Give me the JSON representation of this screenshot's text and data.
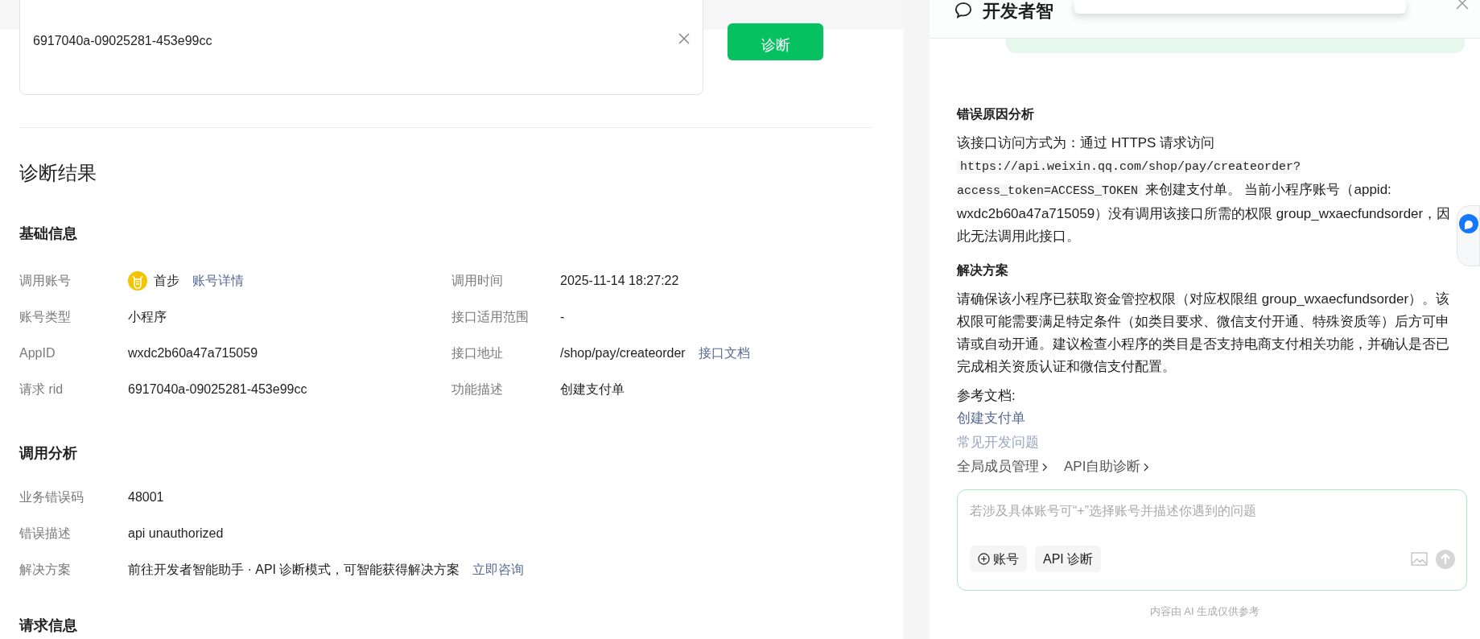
{
  "search": {
    "value": "6917040a-09025281-453e99cc",
    "button": "诊断"
  },
  "result_title": "诊断结果",
  "basic_info": {
    "title": "基础信息",
    "rows": [
      {
        "label": "调用账号",
        "value": "首步",
        "link": "账号详情",
        "avatar": true,
        "label2": "调用时间",
        "value2": "2025-11-14 18:27:22"
      },
      {
        "label": "账号类型",
        "value": "小程序",
        "label2": "接口适用范围",
        "value2": "-"
      },
      {
        "label": "AppID",
        "value": "wxdc2b60a47a715059",
        "label2": "接口地址",
        "value2": "/shop/pay/createorder",
        "link2": "接口文档"
      },
      {
        "label": "请求 rid",
        "value": "6917040a-09025281-453e99cc",
        "label2": "功能描述",
        "value2": "创建支付单"
      }
    ]
  },
  "analysis": {
    "title": "调用分析",
    "rows": [
      {
        "label": "业务错误码",
        "value": "48001"
      },
      {
        "label": "错误描述",
        "value": "api unauthorized"
      },
      {
        "label": "解决方案",
        "value": "前往开发者智能助手 · API 诊断模式，可智能获得解决方案",
        "link": "立即咨询"
      }
    ]
  },
  "request_info_title": "请求信息",
  "assistant": {
    "title": "开发者智",
    "sections": [
      {
        "title": "错误原因分析",
        "parts": [
          {
            "kind": "text",
            "text": "该接口访问方式为：通过 HTTPS 请求访问 "
          },
          {
            "kind": "code",
            "text": "https://api.weixin.qq.com/shop/pay/createorder?access_token=ACCESS_TOKEN"
          },
          {
            "kind": "text",
            "text": " 来创建支付单。 当前小程序账号（appid: wxdc2b60a47a715059）没有调用该接口所需的权限 group_wxaecfundsorder，因此无法调用此接口。"
          }
        ]
      },
      {
        "title": "解决方案",
        "parts": [
          {
            "kind": "text",
            "text": "请确保该小程序已获取资金管控权限（对应权限组 group_wxaecfundsorder）。该权限可能需要满足特定条件（如类目要求、微信支付开通、特殊资质等）后方可申请或自动开通。建议检查小程序的类目是否支持电商支付相关功能，并确认是否已完成相关资质认证和微信支付配置。"
          }
        ]
      }
    ],
    "refs_label": "参考文档:",
    "refs": [
      {
        "text": "创建支付单",
        "faded": false
      },
      {
        "text": "常见开发问题",
        "faded": true
      }
    ],
    "quick_links": [
      "全局成员管理",
      "API自助诊断"
    ],
    "input": {
      "placeholder": "若涉及具体账号可“+”选择账号并描述你遇到的问题",
      "chips": [
        {
          "kind": "account",
          "text": "账号"
        },
        {
          "kind": "plain",
          "text": "API 诊断"
        }
      ]
    },
    "footer": "内容由 AI 生成仅供参考"
  }
}
